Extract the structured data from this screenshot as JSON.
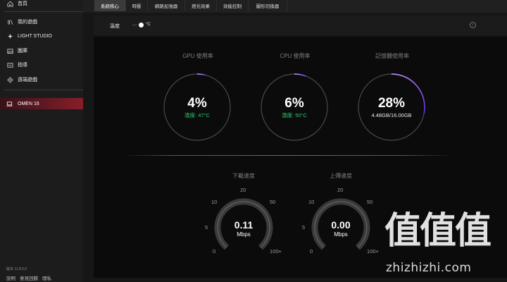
{
  "sidebar": {
    "items": [
      {
        "label": "首頁",
        "icon": "home-icon"
      },
      {
        "label": "我的遊戲",
        "icon": "games-icon"
      },
      {
        "label": "LIGHT STUDIO",
        "icon": "light-studio-icon"
      },
      {
        "label": "圖庫",
        "icon": "gallery-icon"
      },
      {
        "label": "指導",
        "icon": "guide-icon"
      },
      {
        "label": "遠端遊戲",
        "icon": "remote-play-icon"
      }
    ],
    "device": {
      "label": "OMEN 16",
      "icon": "laptop-icon"
    },
    "version": "版本 11.8.5.0",
    "footer": [
      "說明",
      "意見回饋",
      "隱私"
    ]
  },
  "tabs": [
    "系統核心",
    "時壓",
    "網路加強器",
    "燈光效果",
    "效能控制",
    "圖形切換器"
  ],
  "active_tab": 0,
  "subbar": {
    "temp_label": "溫度",
    "unit": "°C"
  },
  "gauges": [
    {
      "title": "GPU 使用率",
      "value": "4%",
      "sub": "溫度: 47°C",
      "percent": 4
    },
    {
      "title": "CPU 使用率",
      "value": "6%",
      "sub": "溫度: 50°C",
      "percent": 6
    },
    {
      "title": "記憶體使用率",
      "value": "28%",
      "sub": "4.48GB/16.00GB",
      "percent": 28
    }
  ],
  "speed": [
    {
      "title": "下載速度",
      "value": "0.11",
      "unit": "Mbps"
    },
    {
      "title": "上傳速度",
      "value": "0.00",
      "unit": "Mbps"
    }
  ],
  "speed_ticks": [
    "0",
    "5",
    "10",
    "20",
    "50",
    "100+"
  ],
  "colors": {
    "accent": "#7b3fe4",
    "temp": "#2ecc71",
    "device_bar": "#8a1d28"
  },
  "watermark": {
    "big": "值值值",
    "small": "zhizhizhi.com"
  }
}
